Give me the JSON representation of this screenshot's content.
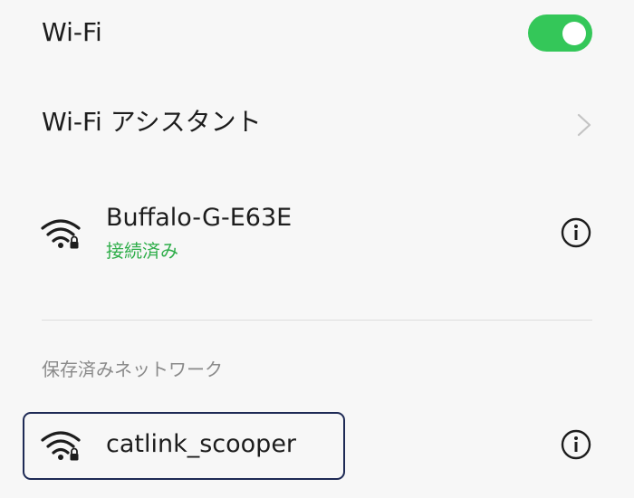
{
  "wifi": {
    "label": "Wi-Fi",
    "enabled": true,
    "toggle_color": "#34c759"
  },
  "assistant": {
    "label": "Wi-Fi アシスタント",
    "icon": "chevron-right-icon"
  },
  "connected_network": {
    "ssid": "Buffalo-G-E63E",
    "status": "接続済み",
    "status_color": "#2fae4a",
    "icon": "wifi-locked-icon",
    "info_icon": "info-icon"
  },
  "saved_section": {
    "header": "保存済みネットワーク",
    "networks": [
      {
        "ssid": "catlink_scooper",
        "icon": "wifi-locked-icon",
        "info_icon": "info-icon",
        "highlighted": true
      }
    ]
  }
}
